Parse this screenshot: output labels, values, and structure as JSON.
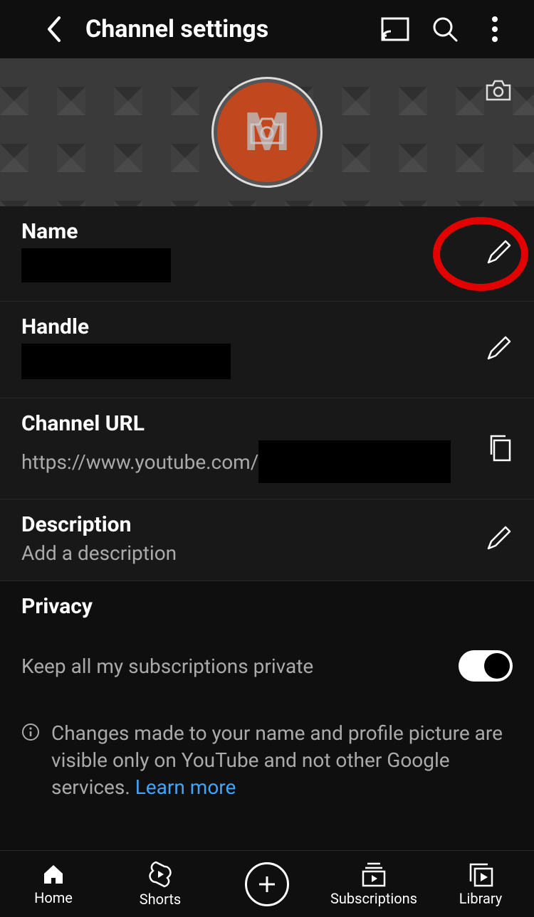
{
  "header": {
    "title": "Channel settings"
  },
  "avatar": {
    "letter": "M"
  },
  "rows": {
    "name": {
      "label": "Name"
    },
    "handle": {
      "label": "Handle"
    },
    "url": {
      "label": "Channel URL",
      "prefix": "https://www.youtube.com/"
    },
    "description": {
      "label": "Description",
      "value": "Add a description"
    }
  },
  "privacy": {
    "heading": "Privacy",
    "subscriptions_label": "Keep all my subscriptions private",
    "subscriptions_on": true
  },
  "info": {
    "text": "Changes made to your name and profile picture are visible only on YouTube and not other Google services.",
    "link": "Learn more"
  },
  "nav": {
    "home": "Home",
    "shorts": "Shorts",
    "subscriptions": "Subscriptions",
    "library": "Library"
  }
}
